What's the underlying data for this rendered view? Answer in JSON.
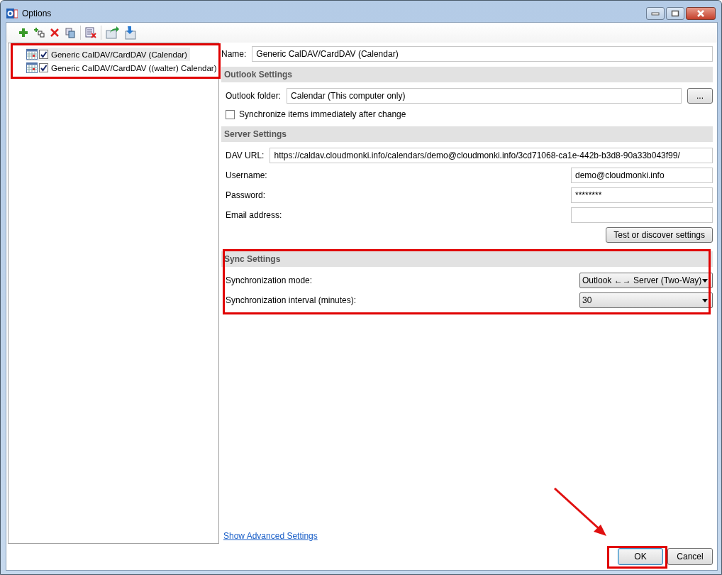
{
  "window": {
    "title": "Options"
  },
  "profiles": [
    {
      "name": "Generic CalDAV/CardDAV (Calendar)",
      "checked": true,
      "selected": true
    },
    {
      "name": "Generic CalDAV/CardDAV ((walter) Calendar)",
      "checked": true,
      "selected": false
    }
  ],
  "name_field": {
    "label": "Name:",
    "value": "Generic CalDAV/CardDAV (Calendar)"
  },
  "outlook_settings": {
    "title": "Outlook Settings",
    "folder_label": "Outlook folder:",
    "folder_value": "Calendar (This computer only)",
    "browse_button": "...",
    "sync_immediately": {
      "label": "Synchronize items immediately after change",
      "checked": false
    }
  },
  "server_settings": {
    "title": "Server Settings",
    "fields": [
      {
        "label": "DAV URL:",
        "value": "https://caldav.cloudmonki.info/calendars/demo@cloudmonki.info/3cd71068-ca1e-442b-b3d8-90a33b043f99/",
        "kind": "wide"
      },
      {
        "label": "Username:",
        "value": "demo@cloudmonki.info",
        "kind": "short"
      },
      {
        "label": "Password:",
        "value": "********",
        "kind": "short"
      },
      {
        "label": "Email address:",
        "kind": "short"
      }
    ],
    "test_button": "Test or discover settings"
  },
  "sync_settings": {
    "title": "Sync Settings",
    "dropdowns": [
      {
        "label": "Synchronization mode:",
        "value": "Outlook ←→ Server (Two-Way)"
      },
      {
        "label": "Synchronization interval (minutes):",
        "value": "30"
      }
    ]
  },
  "advanced_link": "Show Advanced Settings",
  "buttons": [
    {
      "label": "OK",
      "default": true
    },
    {
      "label": "Cancel",
      "default": false
    }
  ]
}
